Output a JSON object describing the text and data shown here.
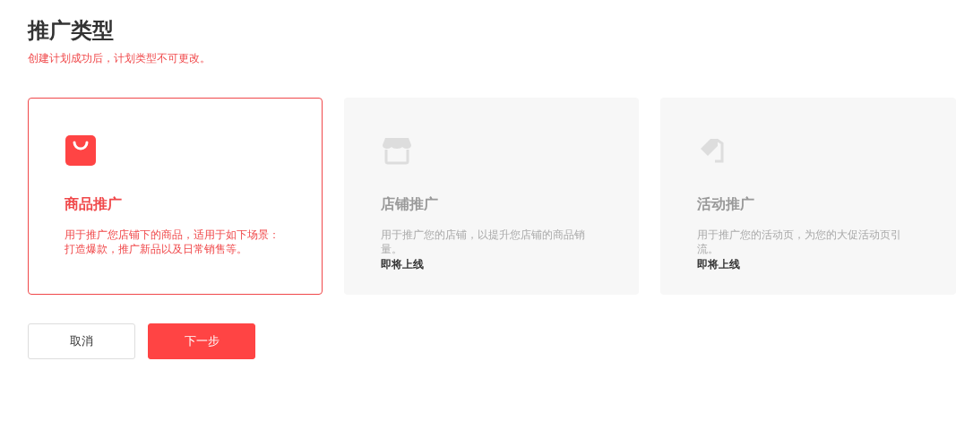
{
  "title": "推广类型",
  "notice": "创建计划成功后，计划类型不可更改。",
  "types": [
    {
      "kind": "product",
      "title": "商品推广",
      "description": [
        "用于推广您店铺下的商品，适用于如下场景：",
        "打造爆款，推广新品以及日常销售等。"
      ],
      "selected": true,
      "disabled": false
    },
    {
      "kind": "store",
      "title": "店铺推广",
      "description": [
        "用于推广您的店铺，以提升您店铺的商品销",
        "量。"
      ],
      "status": "即将上线",
      "selected": false,
      "disabled": true
    },
    {
      "kind": "event",
      "title": "活动推广",
      "description": [
        "用于推广您的活动页，为您的大促活动页引",
        "流。"
      ],
      "status": "即将上线",
      "selected": false,
      "disabled": true
    }
  ],
  "buttons": [
    {
      "label": "取消",
      "kind": "secondary"
    },
    {
      "label": "下一步",
      "kind": "primary"
    }
  ]
}
